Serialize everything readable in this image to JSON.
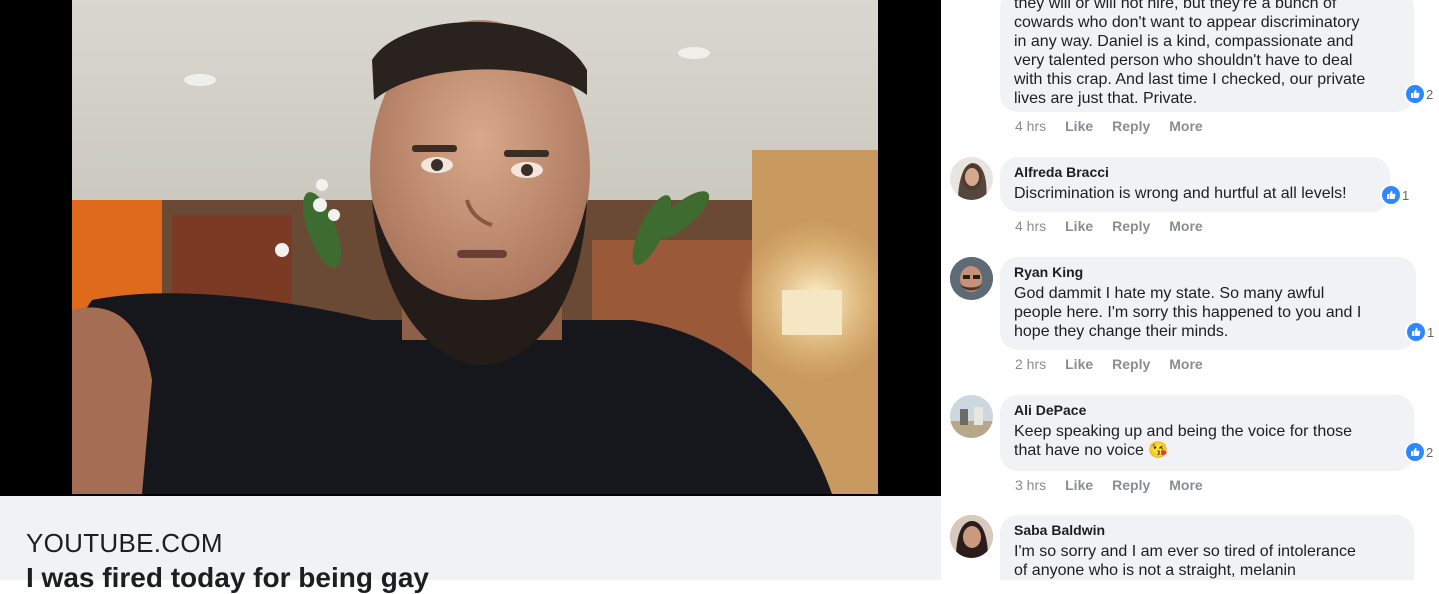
{
  "link_preview": {
    "domain": "YOUTUBE.COM",
    "title": "I was fired today for being gay"
  },
  "comments": [
    {
      "author": "",
      "lines": [
        "they will or will not hire, but they're a bunch of",
        "cowards who don't want to appear discriminatory",
        "in any way. Daniel is a kind, compassionate and",
        "very talented person who shouldn't have to deal",
        "with this crap. And last time I checked, our private",
        "lives are just that. Private."
      ],
      "reactions": "2",
      "time": "4 hrs",
      "like": "Like",
      "reply": "Reply",
      "more": "More"
    },
    {
      "author": "Alfreda Bracci",
      "lines": [
        "Discrimination is wrong and hurtful at all levels!"
      ],
      "reactions": "1",
      "time": "4 hrs",
      "like": "Like",
      "reply": "Reply",
      "more": "More"
    },
    {
      "author": "Ryan King",
      "lines": [
        "God dammit I hate my state. So many awful",
        "people here. I'm sorry this happened to you and I",
        "hope they change their minds."
      ],
      "reactions": "1",
      "time": "2 hrs",
      "like": "Like",
      "reply": "Reply",
      "more": "More"
    },
    {
      "author": "Ali DePace",
      "lines": [
        "Keep speaking up and being the voice for those",
        "that have no voice 😘"
      ],
      "reactions": "2",
      "time": "3 hrs",
      "like": "Like",
      "reply": "Reply",
      "more": "More"
    },
    {
      "author": "Saba Baldwin",
      "lines": [
        "I'm so sorry and I am ever so tired of intolerance",
        "of anyone who is not a straight, melanin"
      ],
      "reactions": "",
      "time": "",
      "like": "",
      "reply": "",
      "more": ""
    }
  ],
  "colors": {
    "bubble": "#f0f2f5",
    "like_blue": "#2d88ff",
    "meta_text": "#8a8d91"
  }
}
